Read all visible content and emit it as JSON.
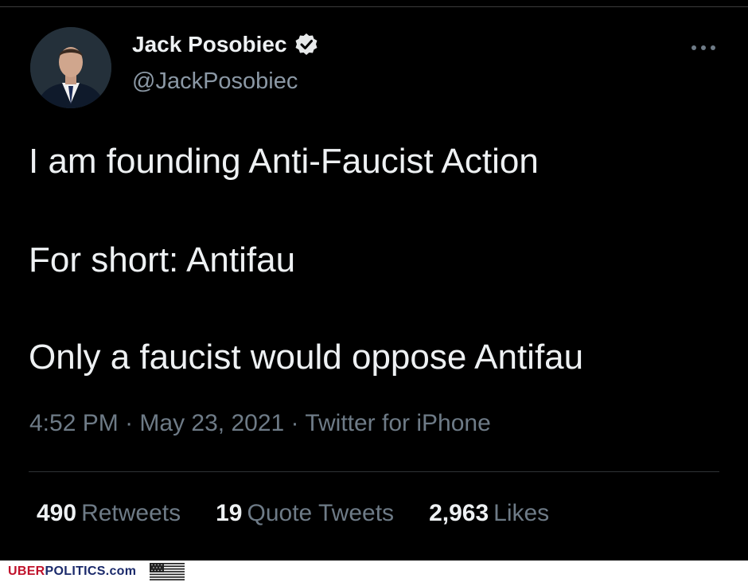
{
  "tweet": {
    "author_name": "Jack Posobiec",
    "handle": "@JackPosobiec",
    "verified": true,
    "lines": [
      "I am founding Anti-Faucist Action",
      "For short: Antifau",
      "Only a faucist would oppose Antifau"
    ],
    "time": "4:52 PM",
    "date": "May 23, 2021",
    "source": "Twitter for iPhone",
    "separator": " · "
  },
  "stats": [
    {
      "count": "490",
      "label": "Retweets"
    },
    {
      "count": "19",
      "label": "Quote Tweets"
    },
    {
      "count": "2,963",
      "label": "Likes"
    }
  ],
  "icons": {
    "more": "more-horizontal-icon",
    "verified": "verified-badge-icon",
    "flag": "us-flag-icon"
  },
  "watermark": {
    "part1": "UBER",
    "part2": "POLITICS.com",
    "color1": "#c0122b",
    "color2": "#1b2a6b"
  },
  "colors": {
    "background": "#000000",
    "text": "#eef1f3",
    "secondary": "#6e7b87",
    "handle": "#8b98a5"
  }
}
